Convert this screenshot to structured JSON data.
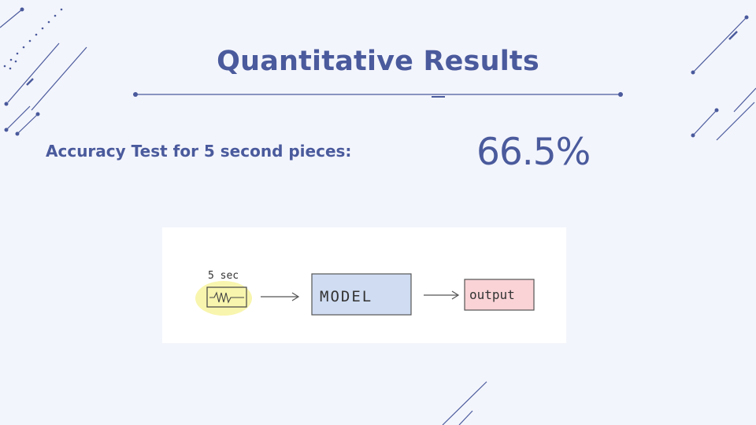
{
  "slide": {
    "title": "Quantitative Results",
    "metric_label": "Accuracy Test for 5 second pieces:",
    "metric_value": "66.5%"
  },
  "diagram": {
    "duration_label": "5 sec",
    "model_label": "MODEL",
    "output_label": "output"
  },
  "colors": {
    "accent": "#4a5a9c",
    "background": "#f3f5fc",
    "input_highlight": "#f7f3a0",
    "model_fill": "#cfdcf2",
    "output_fill": "#f9d3d6"
  },
  "icons": [
    "waveform-icon",
    "arrow-right-icon"
  ]
}
